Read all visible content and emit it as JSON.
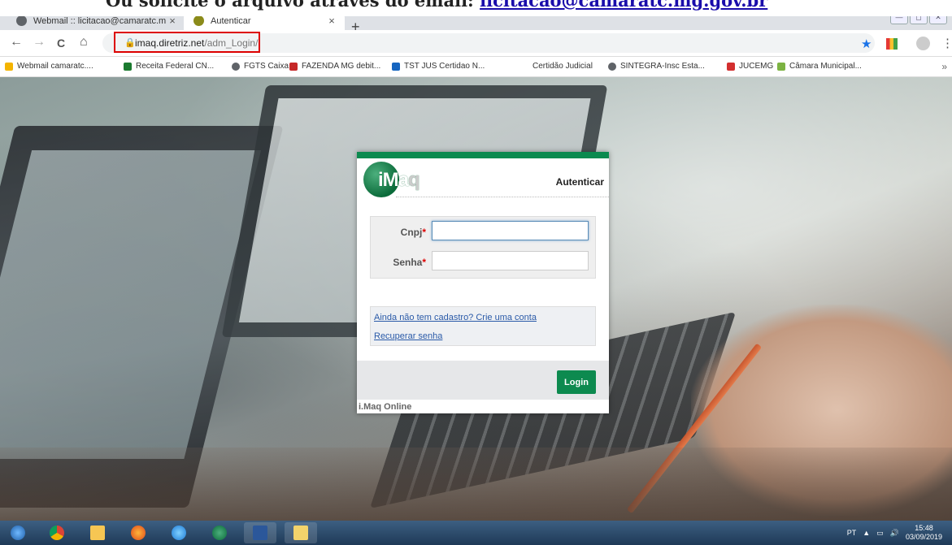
{
  "banner": {
    "prefix": "Ou solicite o arquivo através do email: ",
    "email": "licitacao@camaratc.mg.gov.br"
  },
  "tabs": [
    {
      "label": "Webmail :: licitacao@camaratc.mg",
      "close": "×",
      "color": "#5f6368"
    },
    {
      "label": "Autenticar",
      "close": "×",
      "color": "#8b8b1a"
    }
  ],
  "new_tab": "+",
  "nav": {
    "back": "←",
    "forward": "→",
    "reload": "C",
    "home": "⌂",
    "lock": "🔒",
    "star": "★",
    "menu": "⋮"
  },
  "address": {
    "host": "imaq.diretriz.net",
    "path": "/adm_Login/"
  },
  "window_controls": [
    "—",
    "◻",
    "✕"
  ],
  "bookmarks": [
    {
      "label": "Webmail camaratc....",
      "color": "#f4b400"
    },
    {
      "label": "Receita Federal CN...",
      "color": "#1b7a2f"
    },
    {
      "label": "FGTS Caixa",
      "color": "#5f6368"
    },
    {
      "label": "FAZENDA MG debit...",
      "color": "#c62828"
    },
    {
      "label": "TST JUS Certidao N...",
      "color": "#1565c0"
    },
    {
      "label": "Certidão Judicial",
      "color": ""
    },
    {
      "label": "SINTEGRA-Insc Esta...",
      "color": "#5f6368"
    },
    {
      "label": "JUCEMG",
      "color": "#d32f2f"
    },
    {
      "label": "Câmara Municipal...",
      "color": "#7cb342"
    }
  ],
  "bookmarks_more": "»",
  "login": {
    "logo": {
      "main": "iMa",
      "tail": "q"
    },
    "title": "Autenticar",
    "cnpj_label": "Cnpj",
    "senha_label": "Senha",
    "required_mark": "*",
    "cnpj_value": "",
    "senha_value": "",
    "link_signup": "Ainda não tem cadastro? Crie uma conta",
    "link_recover": "Recuperar senha",
    "button": "Login",
    "brand": "i.Maq Online"
  },
  "taskbar": {
    "icons": [
      "windows-start-icon",
      "chrome-icon",
      "file-explorer-icon",
      "firefox-icon",
      "internet-explorer-icon",
      "imaq-icon",
      "word-icon",
      "folder-icon"
    ],
    "language": "PT",
    "time": "15:48",
    "date": "03/09/2019"
  }
}
